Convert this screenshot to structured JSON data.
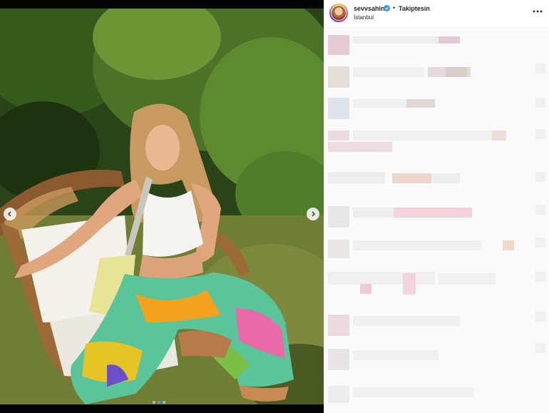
{
  "post": {
    "username": "sevvsahin",
    "follow_state": "Takiptesin",
    "separator": "•",
    "location": "İstanbul"
  },
  "carousel": {
    "slide_count": 3,
    "active_slide": 2
  },
  "icons": {
    "verified": "verified-badge-icon",
    "more": "more-options-icon",
    "prev": "chevron-left-icon",
    "next": "chevron-right-icon"
  },
  "colors": {
    "verified_blue": "#3897f0",
    "text": "#262626",
    "border": "#efefef"
  }
}
